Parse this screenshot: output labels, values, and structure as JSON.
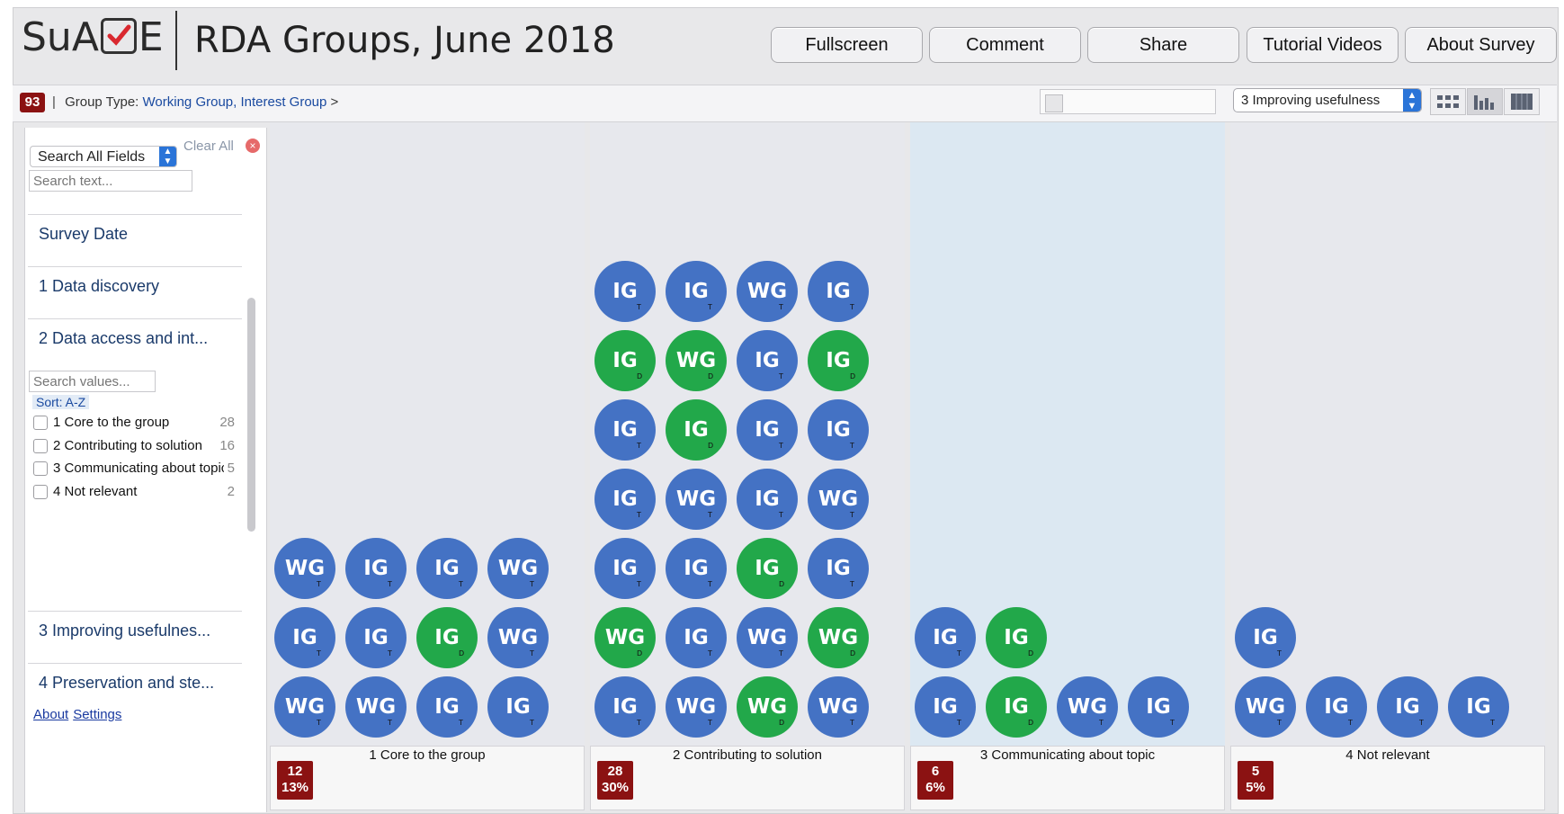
{
  "header": {
    "logo_left": "SuA",
    "logo_right": "E",
    "title": "RDA Groups, June 2018",
    "buttons": [
      "Fullscreen",
      "Comment",
      "Share",
      "Tutorial Videos",
      "About Survey"
    ]
  },
  "breadcrumb": {
    "count": "93",
    "separator": "|",
    "label": "Group Type:",
    "value": "Working Group, Interest Group",
    "arrow": ">"
  },
  "toolbar": {
    "view_select": "3 Improving usefulness",
    "views": [
      "grid-view-icon",
      "bar-view-icon",
      "table-view-icon"
    ],
    "active_view": "bar-view-icon"
  },
  "sidebar": {
    "field_select": "Search All Fields",
    "clear_all": "Clear All",
    "search_placeholder": "Search text...",
    "fields": [
      "Survey Date",
      "1 Data discovery",
      "2 Data access and int...",
      "3 Improving usefulnes...",
      "4 Preservation and ste..."
    ],
    "values_placeholder": "Search values...",
    "sort": "Sort: A-Z",
    "options": [
      {
        "label": "1 Core to the group",
        "count": "28"
      },
      {
        "label": "2 Contributing to solution",
        "count": "16"
      },
      {
        "label": "3 Communicating about topic",
        "count": "5"
      },
      {
        "label": "4 Not relevant",
        "count": "2"
      }
    ],
    "about": "About",
    "settings": "Settings"
  },
  "colors": {
    "blue": "#4472c4",
    "green": "#22a84a",
    "badge": "#8b1212",
    "highlight": "#dce8f2"
  },
  "columns": [
    {
      "caption": "1 Core to the group",
      "count": "12",
      "pct": "13%",
      "highlight": false,
      "rows": [
        [
          [
            "WG",
            "T",
            "b"
          ],
          [
            "WG",
            "T",
            "b"
          ],
          [
            "IG",
            "T",
            "b"
          ],
          [
            "IG",
            "T",
            "b"
          ]
        ],
        [
          [
            "IG",
            "T",
            "b"
          ],
          [
            "IG",
            "T",
            "b"
          ],
          [
            "IG",
            "D",
            "g"
          ],
          [
            "WG",
            "T",
            "b"
          ]
        ],
        [
          [
            "WG",
            "T",
            "b"
          ],
          [
            "IG",
            "T",
            "b"
          ],
          [
            "IG",
            "T",
            "b"
          ],
          [
            "WG",
            "T",
            "b"
          ]
        ]
      ]
    },
    {
      "caption": "2 Contributing to solution",
      "count": "28",
      "pct": "30%",
      "highlight": false,
      "rows": [
        [
          [
            "IG",
            "T",
            "b"
          ],
          [
            "WG",
            "T",
            "b"
          ],
          [
            "WG",
            "D",
            "g"
          ],
          [
            "WG",
            "T",
            "b"
          ]
        ],
        [
          [
            "WG",
            "D",
            "g"
          ],
          [
            "IG",
            "T",
            "b"
          ],
          [
            "WG",
            "T",
            "b"
          ],
          [
            "WG",
            "D",
            "g"
          ]
        ],
        [
          [
            "IG",
            "T",
            "b"
          ],
          [
            "IG",
            "T",
            "b"
          ],
          [
            "IG",
            "D",
            "g"
          ],
          [
            "IG",
            "T",
            "b"
          ]
        ],
        [
          [
            "IG",
            "T",
            "b"
          ],
          [
            "WG",
            "T",
            "b"
          ],
          [
            "IG",
            "T",
            "b"
          ],
          [
            "WG",
            "T",
            "b"
          ]
        ],
        [
          [
            "IG",
            "T",
            "b"
          ],
          [
            "IG",
            "D",
            "g"
          ],
          [
            "IG",
            "T",
            "b"
          ],
          [
            "IG",
            "T",
            "b"
          ]
        ],
        [
          [
            "IG",
            "D",
            "g"
          ],
          [
            "WG",
            "D",
            "g"
          ],
          [
            "IG",
            "T",
            "b"
          ],
          [
            "IG",
            "D",
            "g"
          ]
        ],
        [
          [
            "IG",
            "T",
            "b"
          ],
          [
            "IG",
            "T",
            "b"
          ],
          [
            "WG",
            "T",
            "b"
          ],
          [
            "IG",
            "T",
            "b"
          ]
        ]
      ]
    },
    {
      "caption": "3 Communicating about topic",
      "count": "6",
      "pct": "6%",
      "highlight": true,
      "rows": [
        [
          [
            "IG",
            "T",
            "b"
          ],
          [
            "IG",
            "D",
            "g"
          ],
          [
            "WG",
            "T",
            "b"
          ],
          [
            "IG",
            "T",
            "b"
          ]
        ],
        [
          [
            "IG",
            "T",
            "b"
          ],
          [
            "IG",
            "D",
            "g"
          ]
        ]
      ]
    },
    {
      "caption": "4 Not relevant",
      "count": "5",
      "pct": "5%",
      "highlight": false,
      "rows": [
        [
          [
            "WG",
            "T",
            "b"
          ],
          [
            "IG",
            "T",
            "b"
          ],
          [
            "IG",
            "T",
            "b"
          ],
          [
            "IG",
            "T",
            "b"
          ]
        ],
        [
          [
            "IG",
            "T",
            "b"
          ]
        ]
      ]
    }
  ]
}
